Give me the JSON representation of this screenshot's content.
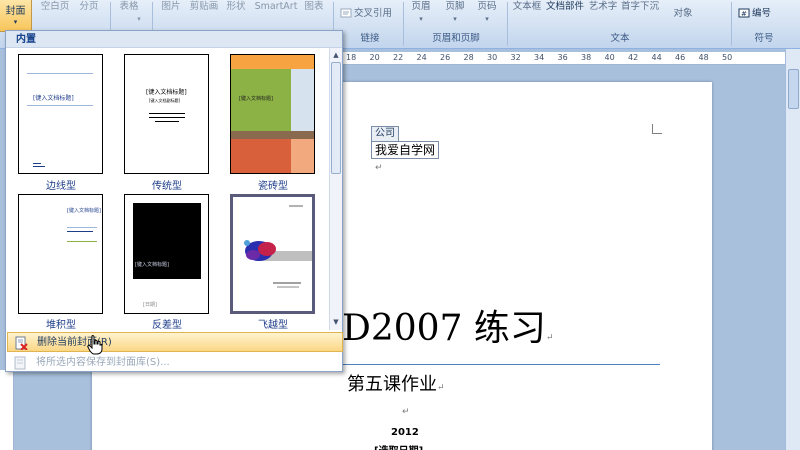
{
  "ribbon": {
    "cover_label": "封面",
    "blank_page": "空白页",
    "page_break": "分页",
    "table": "表格",
    "picture": "图片",
    "clip_art": "剪贴画",
    "shapes": "形状",
    "smartart": "SmartArt",
    "chart": "图表",
    "cross_ref": "交叉引用",
    "header": "页眉",
    "footer": "页脚",
    "page_number": "页码",
    "text_box": "文本框",
    "quick_parts": "文档部件",
    "wordart": "艺术字",
    "drop_cap": "首字下沉",
    "object": "对象",
    "numbering": "编号",
    "groups": {
      "links": "链接",
      "header_footer": "页眉和页脚",
      "text": "文本",
      "symbols": "符号"
    }
  },
  "ruler": {
    "ticks": [
      "18",
      "20",
      "22",
      "24",
      "26",
      "28",
      "30",
      "32",
      "34",
      "36",
      "38",
      "40",
      "42",
      "44",
      "46",
      "48",
      "50"
    ]
  },
  "gallery": {
    "section_title": "内置",
    "templates": [
      {
        "name": "边线型",
        "preview_title": "[键入文档标题]"
      },
      {
        "name": "传统型",
        "preview_title": "[键入文档标题]",
        "preview_sub": "[键入文档副标题]"
      },
      {
        "name": "瓷砖型",
        "preview_title": "[键入文档标题]"
      },
      {
        "name": "堆积型",
        "preview_title": "[键入文档标题]"
      },
      {
        "name": "反差型",
        "preview_title": "[键入文档标题]",
        "preview_footer": "[日期]"
      },
      {
        "name": "飞越型"
      }
    ],
    "menu": {
      "delete_cover": "删除当前封面(R)",
      "save_selection": "将所选内容保存到封面库(S)..."
    }
  },
  "document": {
    "control_tag": "公司",
    "control_value": "我爱自学网",
    "title": "D2007 练习",
    "subtitle": "第五课作业",
    "year": "2012",
    "date_placeholder": "[选取日期]",
    "para_mark": "↵"
  },
  "colors": {
    "ribbon_top": "#e6eff9",
    "ribbon_bottom": "#c2d5ed",
    "highlight_top": "#fff3cf",
    "highlight_bottom": "#fbd786",
    "label_text": "#1f3e8a",
    "title_rule": "#4f81bd"
  }
}
